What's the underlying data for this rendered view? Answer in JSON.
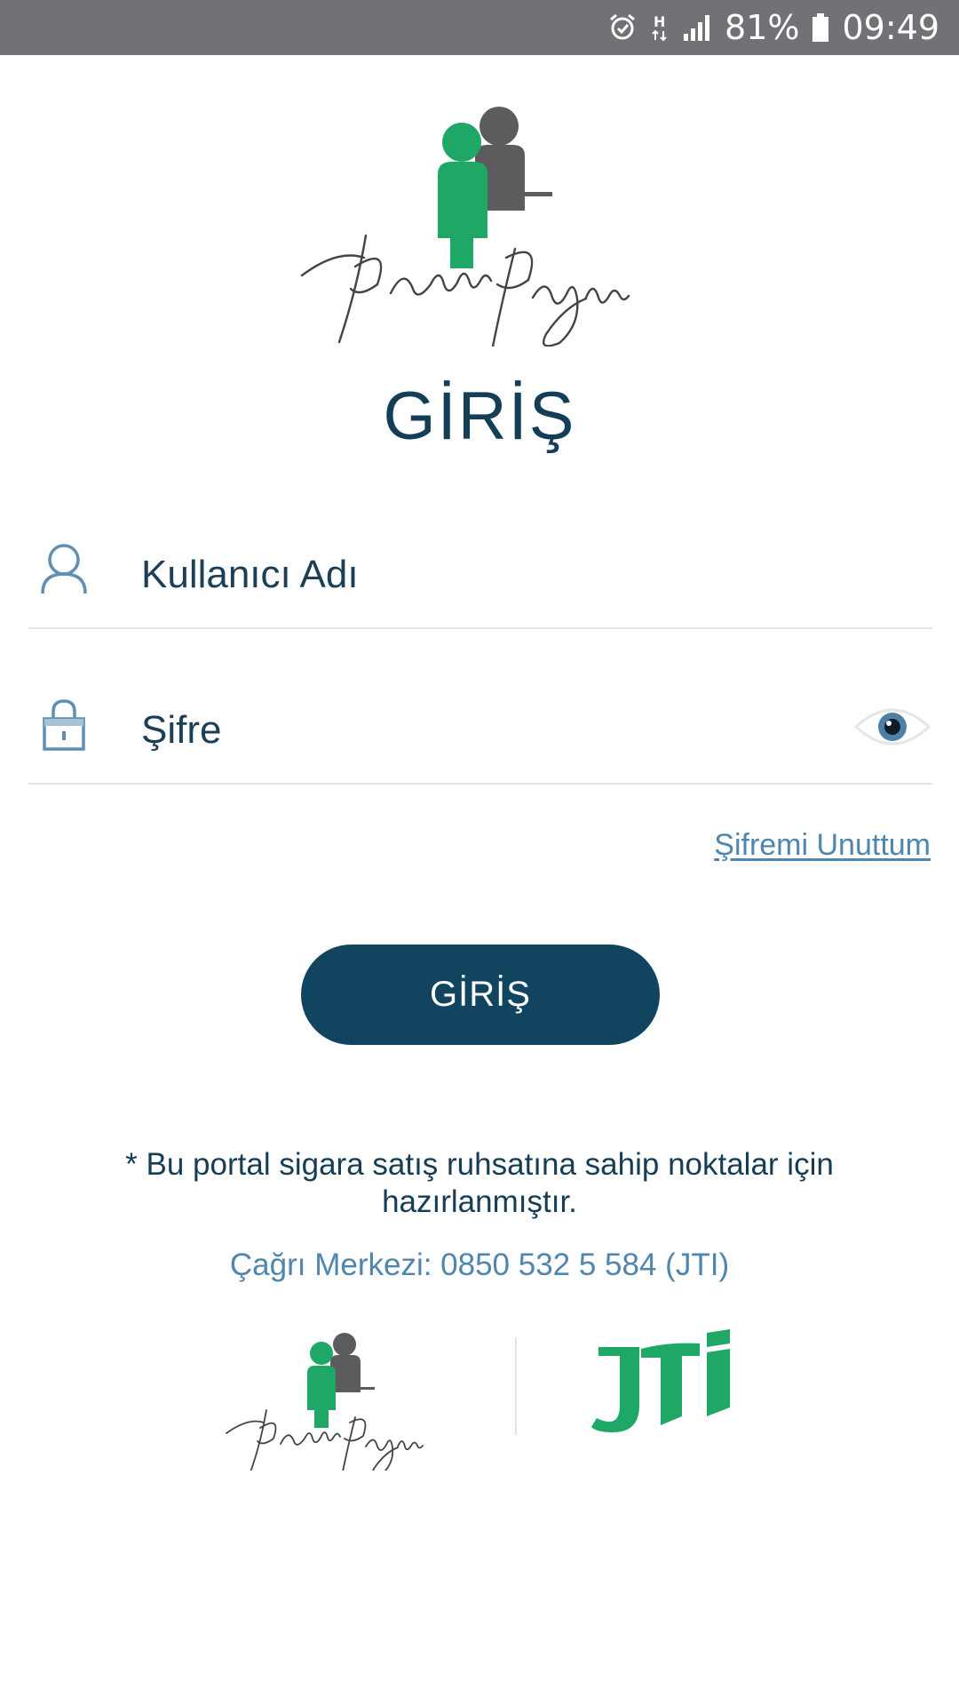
{
  "status_bar": {
    "battery": "81%",
    "time": "09:49",
    "network": "H",
    "icons": [
      "alarm-icon",
      "network-h-icon",
      "signal-icon",
      "battery-icon"
    ]
  },
  "brand": {
    "logo_text": "Benim Bayim",
    "partner_logo_text": "JTI"
  },
  "login": {
    "title": "GİRİŞ",
    "username_placeholder": "Kullanıcı Adı",
    "password_placeholder": "Şifre",
    "forgot_password": "Şifremi Unuttum",
    "submit_label": "GİRİŞ"
  },
  "footer": {
    "notice": "* Bu portal sigara satış ruhsatına sahip noktalar için hazırlanmıştır.",
    "call_center": "Çağrı Merkezi: 0850 532 5 584 (JTI)"
  },
  "colors": {
    "primary": "#10445f",
    "accent": "#4f86ad",
    "logo_green": "#1fa765",
    "logo_gray": "#5c5c5e",
    "status_bar": "#727276"
  }
}
